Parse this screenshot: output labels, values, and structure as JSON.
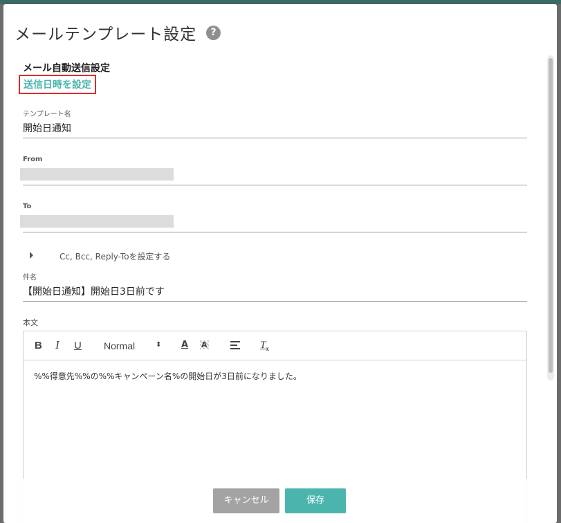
{
  "dialog": {
    "title": "メールテンプレート設定",
    "help_icon": "?",
    "section_heading": "メール自動送信設定",
    "schedule_link": "送信日時を設定"
  },
  "form": {
    "template_name": {
      "label": "テンプレート名",
      "value": "開始日通知"
    },
    "from": {
      "label": "From",
      "value": ""
    },
    "to": {
      "label": "To",
      "value": ""
    },
    "cc_toggle": {
      "icon": "caret-right-icon",
      "label": "Cc, Bcc, Reply-Toを設定する"
    },
    "subject": {
      "label": "件名",
      "value": "【開始日通知】開始日3日前です"
    },
    "body": {
      "label": "本文",
      "toolbar": {
        "bold": "B",
        "italic": "I",
        "underline": "U",
        "format": "Normal",
        "format_caret": "⬍",
        "text_color": "A",
        "background_color": "A",
        "clear_format": "T"
      },
      "content": "%%得意先%%の%%キャンペーン名%の開始日が3日前になりました。"
    }
  },
  "footer": {
    "cancel_label": "キャンセル",
    "save_label": "保存"
  },
  "colors": {
    "accent": "#4bb5ad",
    "highlight_border": "#d9302a",
    "cancel": "#a3a3a3",
    "overlay": "#6b6b6b"
  }
}
